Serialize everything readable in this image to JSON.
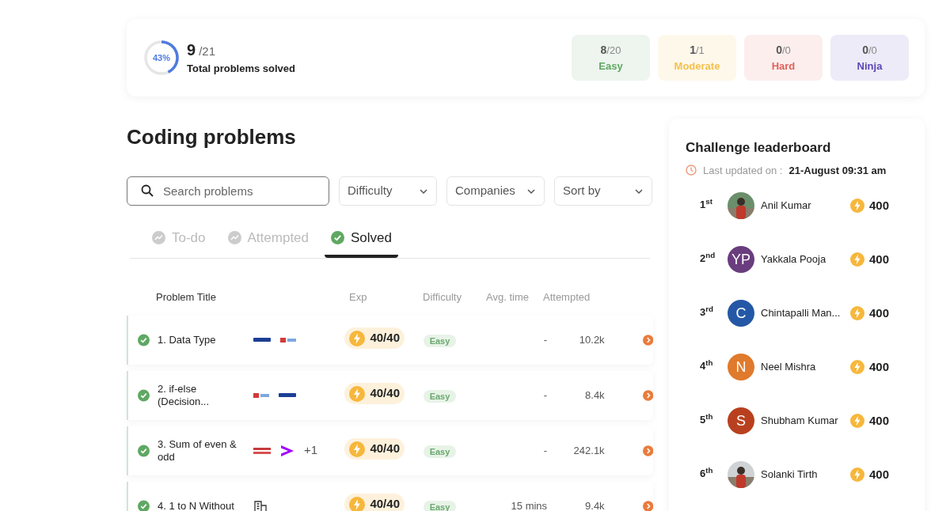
{
  "summary": {
    "percent": "43%",
    "level": 0.43,
    "solved": "9",
    "total": "/21",
    "caption": "Total problems solved",
    "stats": [
      {
        "count": "8",
        "total": "/20",
        "label": "Easy",
        "color": "#5fa862"
      },
      {
        "count": "1",
        "total": "/1",
        "label": "Moderate",
        "color": "#f4c04a"
      },
      {
        "count": "0",
        "total": "/0",
        "label": "Hard",
        "color": "#e0625a"
      },
      {
        "count": "0",
        "total": "/0",
        "label": "Ninja",
        "color": "#5b46b8"
      }
    ]
  },
  "title": "Coding problems",
  "search": {
    "placeholder": "Search problems"
  },
  "filters": [
    "Difficulty",
    "Companies",
    "Sort by"
  ],
  "tabs": [
    {
      "label": "To-do",
      "selected": false
    },
    {
      "label": "Attempted",
      "selected": false
    },
    {
      "label": "Solved",
      "selected": true
    }
  ],
  "table": {
    "columns": [
      "Problem Title",
      "Exp",
      "Difficulty",
      "Avg. time",
      "Attempted"
    ],
    "rows": [
      {
        "title": "1. Data Type",
        "logos": [
          {
            "kind": "wordmark"
          },
          {
            "kind": "tcs"
          }
        ],
        "exp": "40/40",
        "difficulty": "Easy",
        "avg_time": "-",
        "attempted": "10.2k"
      },
      {
        "title": "2. if-else (Decision...",
        "logos": [
          {
            "kind": "tcs"
          },
          {
            "kind": "wordmark"
          }
        ],
        "exp": "40/40",
        "difficulty": "Easy",
        "avg_time": "-",
        "attempted": "8.4k"
      },
      {
        "title": "3. Sum of even & odd",
        "logos": [
          {
            "kind": "red"
          },
          {
            "kind": "chevron"
          }
        ],
        "extra": "+1",
        "exp": "40/40",
        "difficulty": "Easy",
        "avg_time": "-",
        "attempted": "242.1k"
      },
      {
        "title": "4. 1 to N Without",
        "logos": [
          {
            "kind": "building"
          }
        ],
        "exp": "40/40",
        "difficulty": "Easy",
        "avg_time": "15 mins",
        "attempted": "9.4k"
      }
    ]
  },
  "leaderboard": {
    "title": "Challenge leaderboard",
    "updated_label": "Last updated on :",
    "updated_value": "21-August 09:31 am",
    "entries": [
      {
        "rank": "1$^{st}$",
        "name": "Anil Kumar",
        "points": "400"
      },
      {
        "rank": "2$^{nd}$",
        "name": "Yakkala Pooja",
        "points": "400",
        "avatar": {
          "kind": "initials",
          "initials": "YP",
          "color": "#6a3d7e"
        }
      },
      {
        "rank": "3$^{rd}$",
        "name": "Chintapalli Man...",
        "points": "400",
        "avatar": {
          "kind": "initials",
          "initials": "C",
          "color": "#2458a6"
        }
      },
      {
        "rank": "4$^{th}$",
        "name": "Neel Mishra",
        "points": "400",
        "avatar": {
          "kind": "initials",
          "initials": "N",
          "color": "#e07a2c"
        }
      },
      {
        "rank": "5$^{th}$",
        "name": "Shubham Kumar",
        "points": "400",
        "avatar": {
          "kind": "initials",
          "initials": "S",
          "color": "#b8401f"
        }
      },
      {
        "rank": "6$^{th}$",
        "name": "Solanki Tirth",
        "points": "400"
      }
    ]
  }
}
